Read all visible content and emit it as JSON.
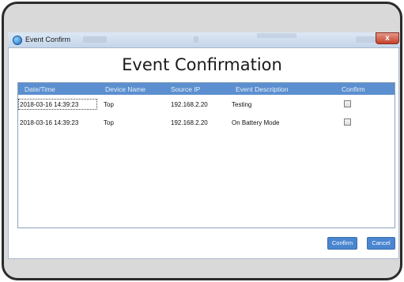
{
  "window": {
    "title": "Event Confirm",
    "close_glyph": "x"
  },
  "heading": "Event Confirmation",
  "table": {
    "columns": [
      "Date/Time",
      "Device Name",
      "Source IP",
      "Event Description",
      "Confirm"
    ],
    "rows": [
      {
        "datetime": "2018-03-16 14:39:23",
        "device": "Top",
        "ip": "192.168.2.20",
        "description": "Testing",
        "confirmed": false
      },
      {
        "datetime": "2018-03-16 14:39:23",
        "device": "Top",
        "ip": "192.168.2.20",
        "description": "On Battery Mode",
        "confirmed": false
      }
    ]
  },
  "buttons": {
    "confirm": "Confirm",
    "cancel": "Cancel"
  },
  "colors": {
    "header_bg": "#5b8fcf",
    "button_bg": "#4a86d0",
    "close_button": "#c7402b"
  }
}
